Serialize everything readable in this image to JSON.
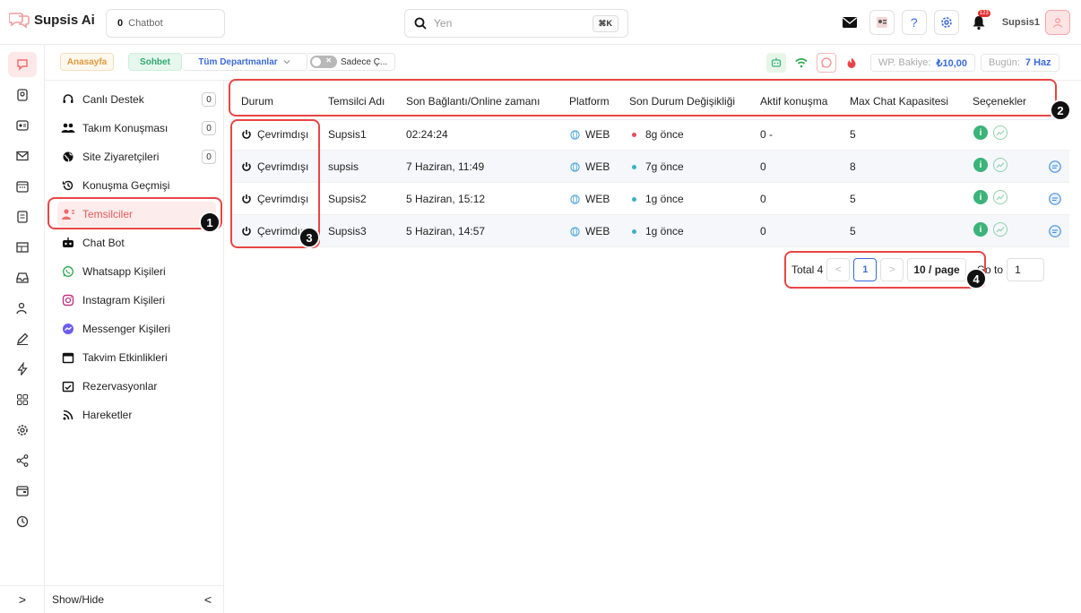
{
  "brand": {
    "name": "Supsis Ai"
  },
  "topbar": {
    "chatbot_count": "0",
    "chatbot_label": "Chatbot",
    "search_placeholder": "Yen",
    "search_shortcut": "⌘K",
    "help_label": "?",
    "bell_badge": "123",
    "username": "Supsis1"
  },
  "tabs": {
    "home": "Anasayfa",
    "chat": "Sohbet",
    "departments": "Tüm Departmanlar",
    "toggle_label": "Sadece Ç...",
    "toggle_state": "✕",
    "wp_label": "WP. Bakiye:",
    "wp_value": "₺10,00",
    "today_label": "Bugün:",
    "today_value": "7 Haz"
  },
  "sidebar": {
    "items": [
      {
        "label": "Canlı Destek",
        "count": "0",
        "icon": "headset-icon"
      },
      {
        "label": "Takım Konuşması",
        "count": "0",
        "icon": "team-icon"
      },
      {
        "label": "Site Ziyaretçileri",
        "count": "0",
        "icon": "globe-icon"
      },
      {
        "label": "Konuşma Geçmişi",
        "icon": "history-icon"
      },
      {
        "label": "Temsilciler",
        "icon": "agents-icon"
      },
      {
        "label": "Chat Bot",
        "icon": "bot-icon"
      },
      {
        "label": "Whatsapp Kişileri",
        "icon": "whatsapp-icon"
      },
      {
        "label": "Instagram Kişileri",
        "icon": "instagram-icon"
      },
      {
        "label": "Messenger Kişileri",
        "icon": "messenger-icon"
      },
      {
        "label": "Takvim Etkinlikleri",
        "icon": "calendar-icon"
      },
      {
        "label": "Rezervasyonlar",
        "icon": "reservation-icon"
      },
      {
        "label": "Hareketler",
        "icon": "feed-icon"
      }
    ],
    "show_hide": "Show/Hide",
    "collapse_glyph": "<",
    "expand_glyph": ">"
  },
  "table": {
    "headers": [
      "Durum",
      "Temsilci Adı",
      "Son Bağlantı/Online zamanı",
      "Platform",
      "Son Durum Değişikliği",
      "Aktif konuşma",
      "Max Chat Kapasitesi",
      "Seçenekler"
    ],
    "rows": [
      {
        "status": "Çevrimdışı",
        "name": "Supsis1",
        "last_seen": "02:24:24",
        "platform": "WEB",
        "change": "8g önce",
        "change_color": "#e8505b",
        "active": "0 -",
        "capacity": "5",
        "has_message": false
      },
      {
        "status": "Çevrimdışı",
        "name": "supsis",
        "last_seen": "7 Haziran, 11:49",
        "platform": "WEB",
        "change": "7g önce",
        "change_color": "#3bb3c3",
        "active": "0",
        "capacity": "8",
        "has_message": true
      },
      {
        "status": "Çevrimdışı",
        "name": "Supsis2",
        "last_seen": "5 Haziran, 15:12",
        "platform": "WEB",
        "change": "1g önce",
        "change_color": "#3bb3c3",
        "active": "0",
        "capacity": "5",
        "has_message": true
      },
      {
        "status": "Çevrimdışı",
        "name": "Supsis3",
        "last_seen": "5 Haziran, 14:57",
        "platform": "WEB",
        "change": "1g önce",
        "change_color": "#3bb3c3",
        "active": "0",
        "capacity": "5",
        "has_message": true
      }
    ],
    "info_glyph": "i"
  },
  "pagination": {
    "total": "Total 4",
    "prev": "<",
    "current": "1",
    "next": ">",
    "page_size": "10 / page",
    "goto_label": "Go to",
    "goto_value": "1"
  },
  "annotations": [
    "1",
    "2",
    "3",
    "4"
  ],
  "colors": {
    "accent": "#e84545",
    "brand_blue": "#3a6bd8",
    "green": "#3bb37a"
  }
}
